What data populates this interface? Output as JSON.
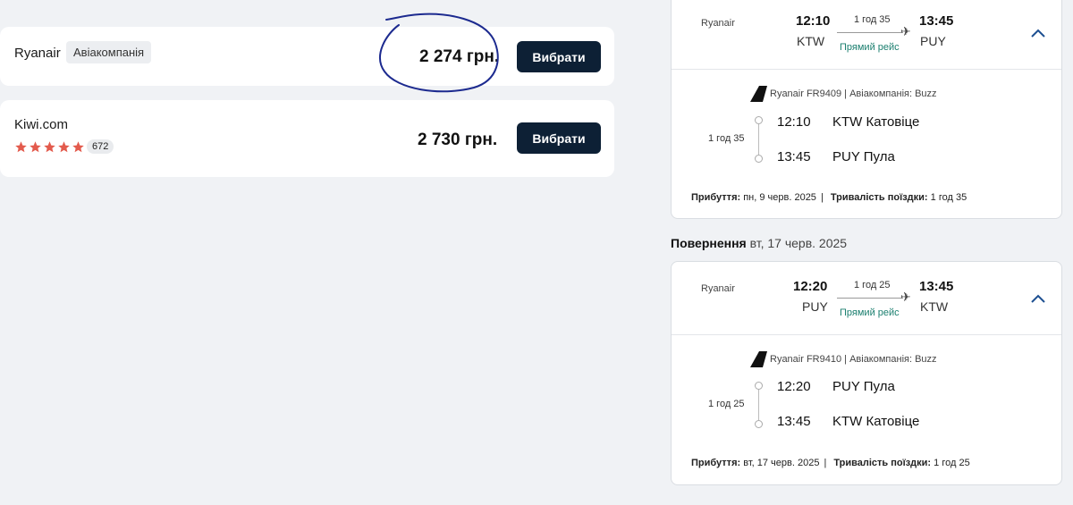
{
  "offers": [
    {
      "provider": "Ryanair",
      "badge": "Авіакомпанія",
      "price": "2 274 грн.",
      "button": "Вибрати"
    },
    {
      "provider": "Kiwi.com",
      "rating_stars": 5,
      "reviews": "672",
      "price": "2 730 грн.",
      "button": "Вибрати"
    }
  ],
  "colors": {
    "button_bg": "#0d2035",
    "star": "#e35b4d",
    "direct": "#1b7f6f",
    "chevron": "#1d4f91",
    "annotation": "#1c2a8f"
  },
  "outbound": {
    "airline": "Ryanair",
    "dep_time": "12:10",
    "dep_code": "KTW",
    "arr_time": "13:45",
    "arr_code": "PUY",
    "duration": "1 год 35",
    "direct": "Прямий рейс",
    "flight_info": "Ryanair FR9409 | Авіакомпанія: Buzz",
    "stop1_time": "12:10",
    "stop1_place": "KTW Катовіце",
    "stop2_time": "13:45",
    "stop2_place": "PUY Пула",
    "segment_duration": "1 год 35",
    "arrival_label": "Прибуття:",
    "arrival_value": "пн, 9 черв. 2025",
    "trip_label": "Тривалість поїздки:",
    "trip_value": "1 год 35"
  },
  "return_section": {
    "title": "Повернення",
    "date": "вт, 17 черв. 2025"
  },
  "inbound": {
    "airline": "Ryanair",
    "dep_time": "12:20",
    "dep_code": "PUY",
    "arr_time": "13:45",
    "arr_code": "KTW",
    "duration": "1 год 25",
    "direct": "Прямий рейс",
    "flight_info": "Ryanair FR9410 | Авіакомпанія: Buzz",
    "stop1_time": "12:20",
    "stop1_place": "PUY Пула",
    "stop2_time": "13:45",
    "stop2_place": "KTW Катовіце",
    "segment_duration": "1 год 25",
    "arrival_label": "Прибуття:",
    "arrival_value": "вт, 17 черв. 2025",
    "trip_label": "Тривалість поїздки:",
    "trip_value": "1 год 25"
  },
  "icons": {
    "expand": "chevron-up-icon",
    "plane": "plane-icon",
    "tail": "airline-tail-icon",
    "star": "star-icon",
    "review": "speech-bubble-icon"
  }
}
